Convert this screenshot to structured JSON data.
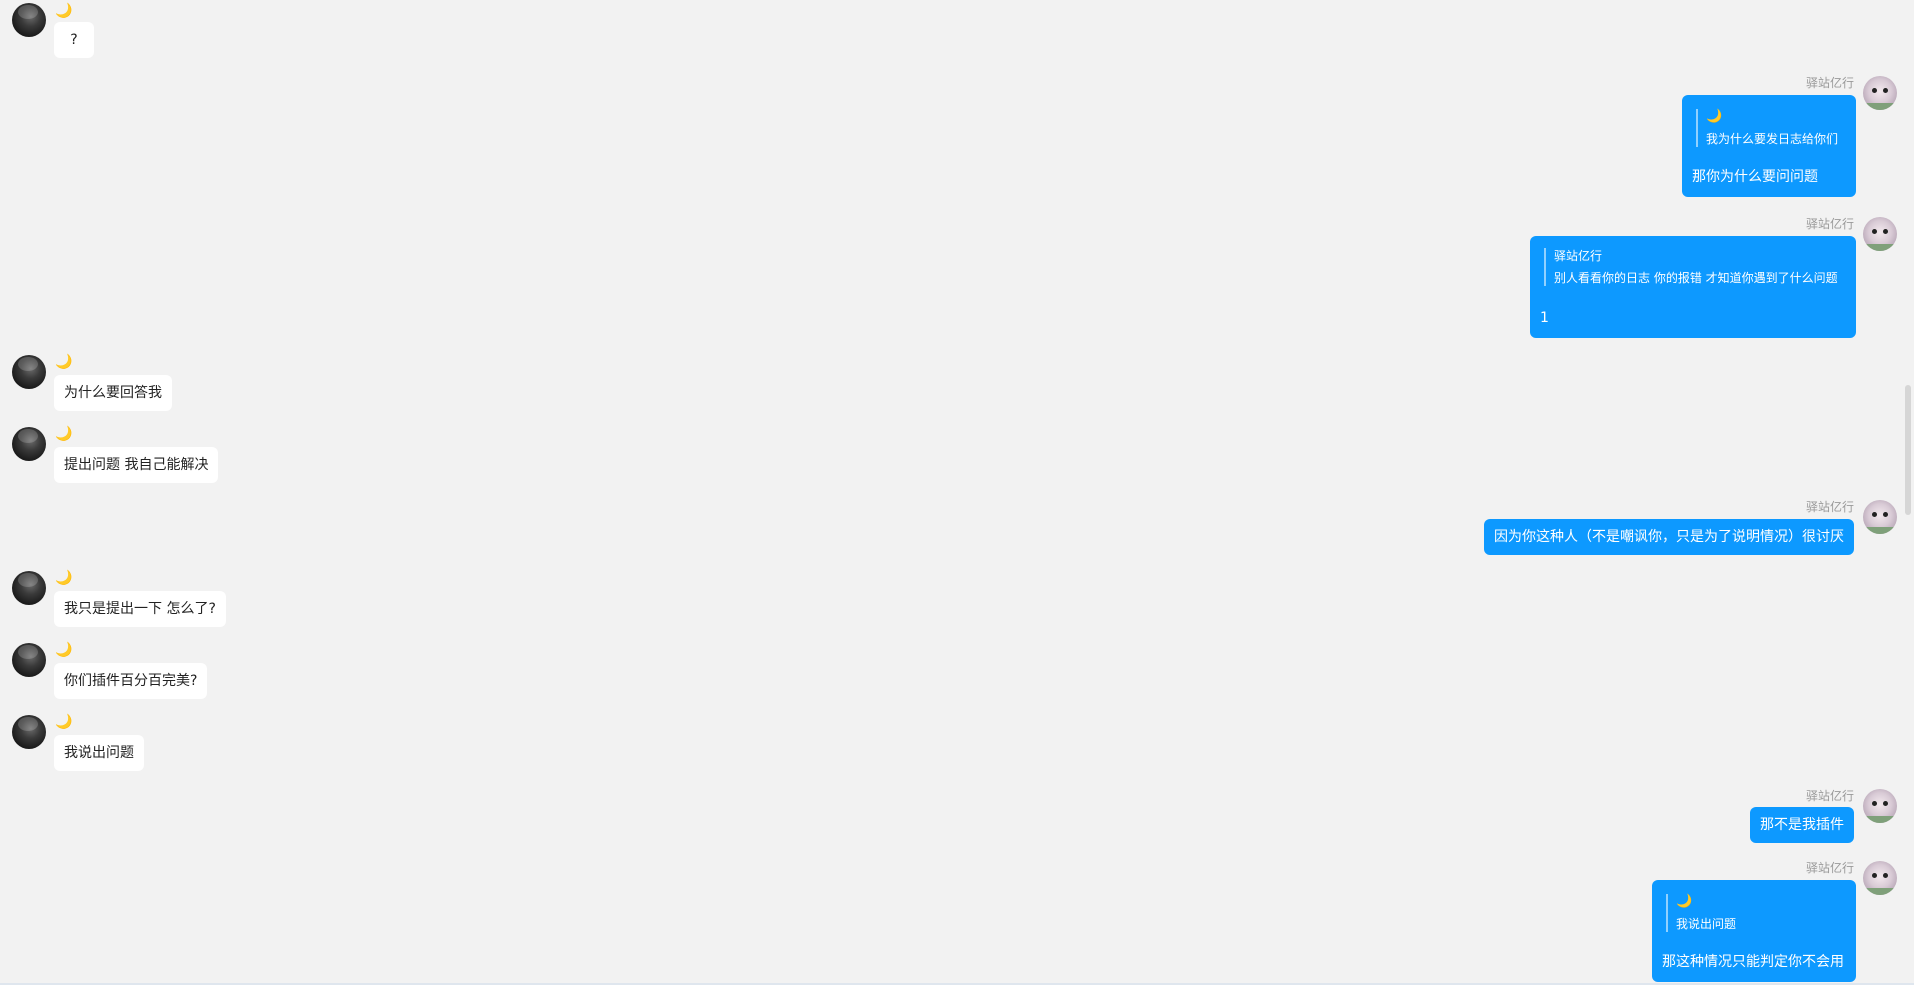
{
  "self_name": "驿站亿行",
  "other_name_icon": "crescent-moon-icon",
  "colors": {
    "background": "#f2f2f2",
    "self_bubble": "#0d99ff",
    "other_bubble": "#ffffff"
  },
  "messages": [
    {
      "side": "in",
      "text": "?"
    },
    {
      "side": "out",
      "sender": "驿站亿行",
      "quote_author_icon": "🌙",
      "quote_text": "我为什么要发日志给你们",
      "text": "那你为什么要问问题"
    },
    {
      "side": "out",
      "sender": "驿站亿行",
      "quote_author": "驿站亿行",
      "quote_text": "别人看看你的日志 你的报错 才知道你遇到了什么问题",
      "text": "1"
    },
    {
      "side": "in",
      "text": "为什么要回答我"
    },
    {
      "side": "in",
      "text": "提出问题 我自己能解决"
    },
    {
      "side": "out",
      "sender": "驿站亿行",
      "text": "因为你这种人（不是嘲讽你，只是为了说明情况）很讨厌"
    },
    {
      "side": "in",
      "text": "我只是提出一下 怎么了?"
    },
    {
      "side": "in",
      "text": "你们插件百分百完美?"
    },
    {
      "side": "in",
      "text": "我说出问题"
    },
    {
      "side": "out",
      "sender": "驿站亿行",
      "text": "那不是我插件"
    },
    {
      "side": "out",
      "sender": "驿站亿行",
      "quote_author_icon": "🌙",
      "quote_text": "我说出问题",
      "text": "那这种情况只能判定你不会用"
    }
  ]
}
